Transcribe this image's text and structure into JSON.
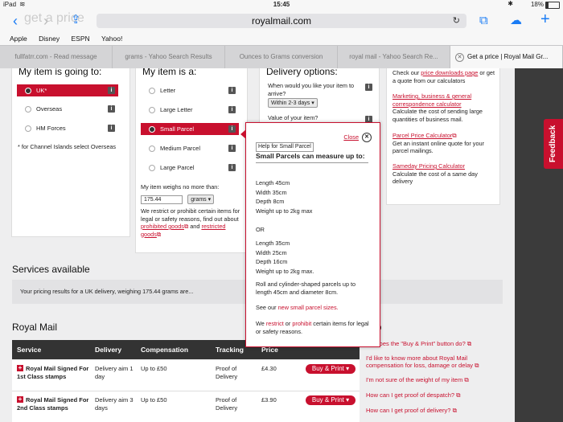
{
  "status": {
    "device": "iPad",
    "time": "15:45",
    "battery": "18%"
  },
  "browser": {
    "url": "royalmail.com",
    "ghost_title": "get a price",
    "bookmarks": [
      "Apple",
      "Disney",
      "ESPN",
      "Yahoo!"
    ],
    "tabs": [
      "fullfatrr.com - Read message",
      "grams - Yahoo Search Results",
      "Ounces to Grams conversion",
      "royal mail - Yahoo Search Re...",
      "Get a price | Royal Mail Gr..."
    ]
  },
  "going_to": {
    "title": "My item is going to:",
    "options": [
      "UK*",
      "Overseas",
      "HM Forces"
    ],
    "note": "* for Channel Islands select Overseas"
  },
  "item_is": {
    "title": "My item is a:",
    "options": [
      "Letter",
      "Large Letter",
      "Small Parcel",
      "Medium Parcel",
      "Large Parcel"
    ],
    "weight_label": "My item weighs no more than:",
    "weight_value": "175.44",
    "weight_unit": "grams",
    "restrict_text": "We restrict or prohibit certain items for legal or safety reasons, find out about",
    "prohibited_link": "prohibited goods",
    "and": "and",
    "restricted_link": "restricted goods"
  },
  "delivery": {
    "title": "Delivery options:",
    "when_label": "When would you like your item to arrive?",
    "when_value": "Within 2-3 days",
    "value_label": "Value of your item?"
  },
  "calculators": {
    "check_text_1": "Check our",
    "downloads_link": "price downloads page",
    "check_text_2": "or get a quote from our calculators",
    "marketing_link": "Marketing, business & general correspondence calculator",
    "marketing_desc": "Calculate the cost of sending large quantities of business mail.",
    "parcel_link": "Parcel Price Calculator",
    "parcel_desc": "Get an instant online quote for your parcel mailings.",
    "sameday_link": "Sameday Pricing Calculator",
    "sameday_desc": "Calculate the cost of a same day delivery"
  },
  "popup": {
    "close": "Close",
    "help_label": "Help for Small Parcel",
    "heading": "Small Parcels can measure up to:",
    "dims1": [
      "Length  45cm",
      "Width  35cm",
      "Depth  8cm",
      "Weight  up to 2kg max"
    ],
    "or": "OR",
    "dims2": [
      "Length 35cm",
      "Width 25cm",
      "Depth 16cm",
      "Weight up to 2kg max."
    ],
    "roll_text": "Roll and cylinder-shaped parcels up to length 45cm and diameter 8cm.",
    "see_text": "See our",
    "sizes_link": "new small parcel sizes.",
    "we": "We",
    "restrict_link": "restrict",
    "or_word": "or",
    "prohibit_link": "prohibit",
    "certain_text": "certain items for legal or safety reasons."
  },
  "services": {
    "title": "Services available",
    "results_text": "Your pricing results for a UK delivery, weighing 175.44 grams are..."
  },
  "royal_mail": {
    "title": "Royal Mail",
    "headers": [
      "Service",
      "Delivery",
      "Compensation",
      "Tracking",
      "Price"
    ],
    "rows": [
      {
        "service": "Royal Mail Signed For 1st Class stamps",
        "delivery": "Delivery aim 1 day",
        "compensation": "Up to £50",
        "tracking": "Proof of Delivery",
        "price": "£4.30",
        "button": "Buy & Print"
      },
      {
        "service": "Royal Mail Signed For 2nd Class stamps",
        "delivery": "Delivery aim 3 days",
        "compensation": "Up to £50",
        "tracking": "Proof of Delivery",
        "price": "£3.90",
        "button": "Buy & Print"
      }
    ]
  },
  "help": {
    "title": "lp",
    "items": [
      "hat does the \"Buy & Print\" button do?",
      "I'd like to know more about Royal Mail compensation for loss, damage or delay",
      "I'm not sure of the weight of my item",
      "How can I get proof of despatch?",
      "How can I get proof of delivery?"
    ]
  },
  "feedback": "Feedback",
  "colors": {
    "brand_red": "#c8102e",
    "ios_blue": "#1a7cf5",
    "dark_header": "#333333"
  }
}
